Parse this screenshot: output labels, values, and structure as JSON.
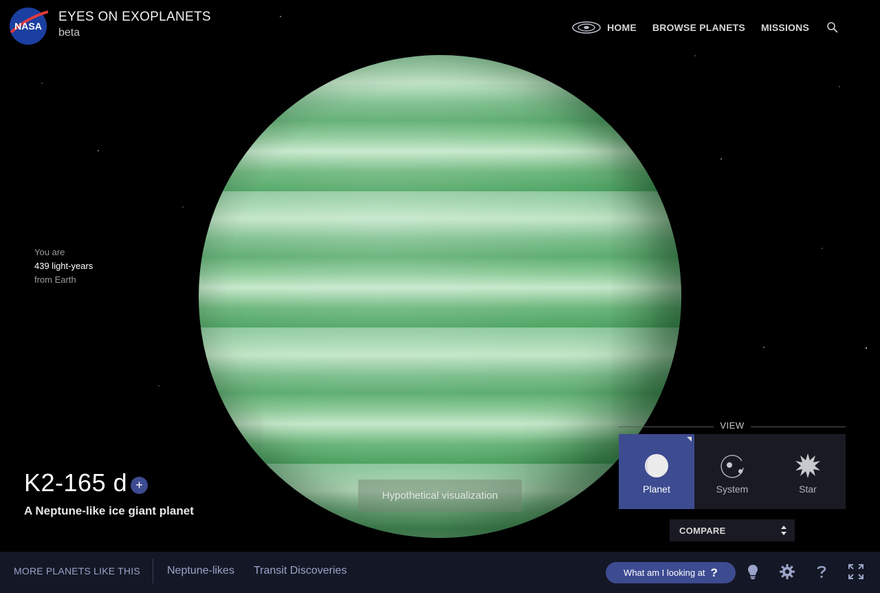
{
  "header": {
    "logo_alt": "NASA",
    "title": "EYES ON EXOPLANETS",
    "subtitle": "beta",
    "nav": {
      "home": "HOME",
      "browse": "BROWSE PLANETS",
      "missions": "MISSIONS"
    },
    "icons": [
      "galaxy-icon",
      "search-icon"
    ]
  },
  "distance": {
    "line1": "You are",
    "value": "439 light-years",
    "line3": "from Earth"
  },
  "planet": {
    "name": "K2-165 d",
    "add_label": "+",
    "description": "A Neptune-like ice giant planet",
    "visualization_note": "Hypothetical visualization",
    "color": "#7fbf8c"
  },
  "view": {
    "label": "VIEW",
    "buttons": [
      {
        "label": "Planet",
        "icon": "planet-icon",
        "active": true
      },
      {
        "label": "System",
        "icon": "system-icon",
        "active": false
      },
      {
        "label": "Star",
        "icon": "star-icon",
        "active": false
      }
    ],
    "compare_label": "COMPARE"
  },
  "footer": {
    "more_label": "MORE PLANETS LIKE THIS",
    "links": [
      "Neptune-likes",
      "Transit Discoveries"
    ],
    "help_button": "What am I looking at",
    "help_glyph": "?",
    "icons": [
      "lightbulb-icon",
      "settings-icon",
      "help-icon",
      "fullscreen-icon"
    ]
  },
  "colors": {
    "accent": "#3d4b91",
    "panel": "#1a1a24",
    "footer_bg": "#141826",
    "footer_text": "#9aa3c8"
  }
}
